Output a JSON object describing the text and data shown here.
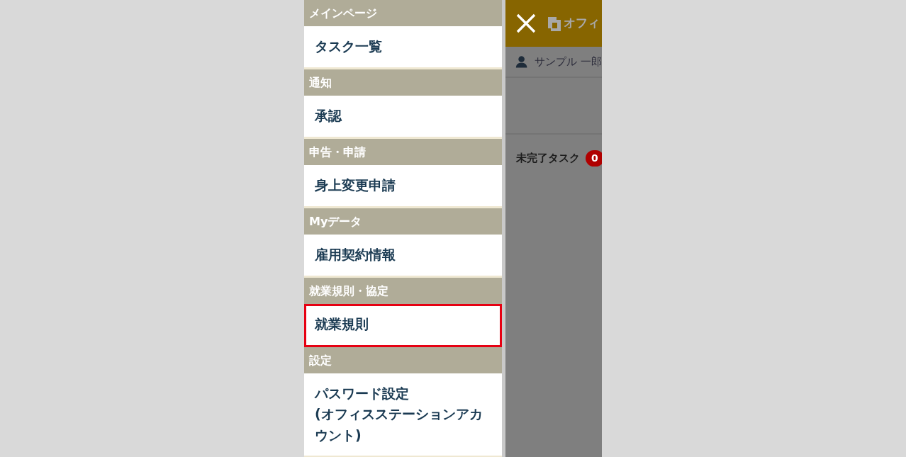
{
  "menu": [
    {
      "heading": "メインページ",
      "items": [
        {
          "label": "タスク一覧",
          "selected": false
        }
      ]
    },
    {
      "heading": "通知",
      "items": [
        {
          "label": "承認",
          "selected": false
        }
      ]
    },
    {
      "heading": "申告・申請",
      "items": [
        {
          "label": "身上変更申請",
          "selected": false
        }
      ]
    },
    {
      "heading": "Myデータ",
      "items": [
        {
          "label": "雇用契約情報",
          "selected": false
        }
      ]
    },
    {
      "heading": "就業規則・協定",
      "items": [
        {
          "label": "就業規則",
          "selected": true
        }
      ]
    },
    {
      "heading": "設定",
      "items": [
        {
          "label": "パスワード設定",
          "sublabel": "(オフィスステーションアカウント)",
          "selected": false
        }
      ]
    }
  ],
  "app": {
    "logo_text": "オフィ",
    "user": "サンプル 一郎",
    "section_title": "未完了タスク",
    "badge": "0"
  }
}
